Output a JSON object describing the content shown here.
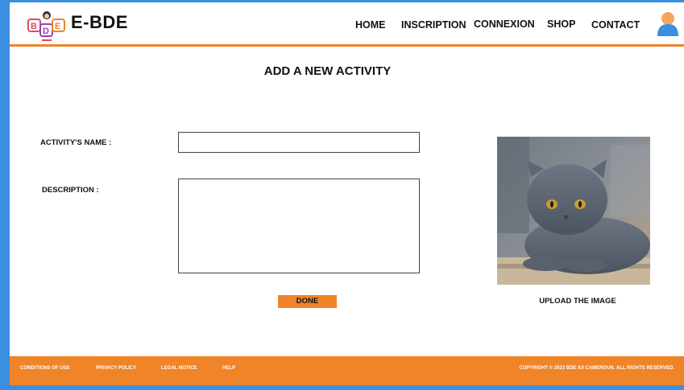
{
  "header": {
    "brand": "E-BDE",
    "nav": [
      "HOME",
      "INSCRIPTION",
      "CONNEXION",
      "SHOP",
      "CONTACT"
    ]
  },
  "main": {
    "title": "ADD A NEW ACTIVITY",
    "name_label": "ACTIVITY'S NAME :",
    "name_value": "",
    "description_label": "DESCRIPTION :",
    "description_value": "",
    "done_label": "DONE",
    "upload_label": "UPLOAD THE IMAGE"
  },
  "footer": {
    "links": [
      "CONDITIONS OF USE",
      "PRIVACY POLICY",
      "LEGAL NOTICE",
      "HELP"
    ],
    "copyright": "COPYRIGHT © 2023 BDE IUI CAMEROUN. ALL RIGHTS RESERVED."
  },
  "colors": {
    "accent": "#f08428",
    "frame": "#3a8fe0"
  }
}
